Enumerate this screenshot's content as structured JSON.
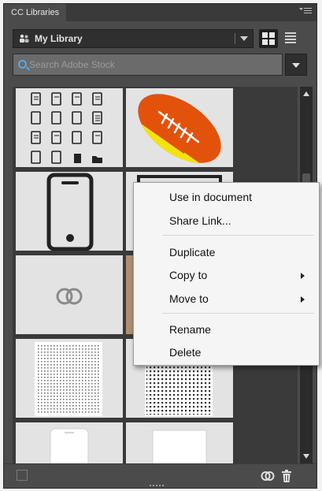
{
  "panel": {
    "tab_title": "CC Libraries",
    "library_name": "My Library",
    "search_placeholder": "Search Adobe Stock"
  },
  "context_menu": {
    "items": [
      {
        "label": "Use in document",
        "submenu": false
      },
      {
        "label": "Share Link...",
        "submenu": false
      },
      {
        "label": "Duplicate",
        "submenu": false
      },
      {
        "label": "Copy to",
        "submenu": true
      },
      {
        "label": "Move to",
        "submenu": true
      },
      {
        "label": "Rename",
        "submenu": false
      },
      {
        "label": "Delete",
        "submenu": false
      }
    ]
  },
  "colors": {
    "panel_bg": "#4b4b4b",
    "tile_bg": "#e3e3e3",
    "football_orange": "#e2520b",
    "football_stripe": "#f4e20e",
    "search_icon": "#5aa8e6"
  },
  "icons": [
    "user-group-icon",
    "chevron-down-icon",
    "grid-view-icon",
    "list-view-icon",
    "search-icon",
    "cc-sync-icon",
    "trash-icon",
    "flyout-menu-icon",
    "submenu-arrow-icon"
  ]
}
